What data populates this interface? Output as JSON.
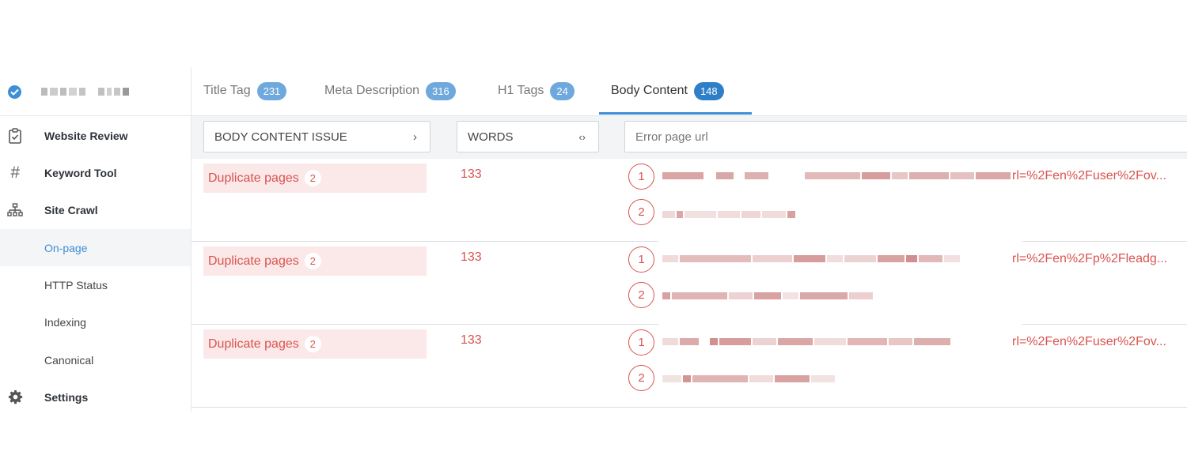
{
  "sidebar": {
    "project_name": "",
    "items": [
      {
        "label": "Website Review",
        "icon": "clipboard-check-icon",
        "kind": "main"
      },
      {
        "label": "Keyword Tool",
        "icon": "hash-icon",
        "kind": "main"
      },
      {
        "label": "Site Crawl",
        "icon": "sitemap-icon",
        "kind": "main"
      },
      {
        "label": "On-page",
        "icon": "",
        "kind": "sub",
        "active": true
      },
      {
        "label": "HTTP Status",
        "icon": "",
        "kind": "sub"
      },
      {
        "label": "Indexing",
        "icon": "",
        "kind": "sub"
      },
      {
        "label": "Canonical",
        "icon": "",
        "kind": "sub"
      },
      {
        "label": "Settings",
        "icon": "gear-icon",
        "kind": "main"
      }
    ]
  },
  "tabs": [
    {
      "label": "Title Tag",
      "count": "231"
    },
    {
      "label": "Meta Description",
      "count": "316"
    },
    {
      "label": "H1 Tags",
      "count": "24"
    },
    {
      "label": "Body Content",
      "count": "148",
      "active": true
    }
  ],
  "filters": {
    "issue_label": "BODY CONTENT ISSUE",
    "issue_arrow": "›",
    "words_label": "WORDS",
    "words_arrow": "‹›",
    "url_placeholder": "Error page url"
  },
  "rows": [
    {
      "issue": "Duplicate pages",
      "count": "2",
      "words": "133",
      "urls": [
        {
          "num": "1",
          "tail": "rl=%2Fen%2Fuser%2Fov..."
        },
        {
          "num": "2",
          "tail": ""
        }
      ]
    },
    {
      "issue": "Duplicate pages",
      "count": "2",
      "words": "133",
      "urls": [
        {
          "num": "1",
          "tail": "rl=%2Fen%2Fp%2Fleadg..."
        },
        {
          "num": "2",
          "tail": ""
        }
      ]
    },
    {
      "issue": "Duplicate pages",
      "count": "2",
      "words": "133",
      "urls": [
        {
          "num": "1",
          "tail": "rl=%2Fen%2Fuser%2Fov..."
        },
        {
          "num": "2",
          "tail": ""
        }
      ]
    }
  ],
  "colors": {
    "accent": "#3d8fd6",
    "error": "#d9534f",
    "error_bg": "#fbe9e9"
  }
}
